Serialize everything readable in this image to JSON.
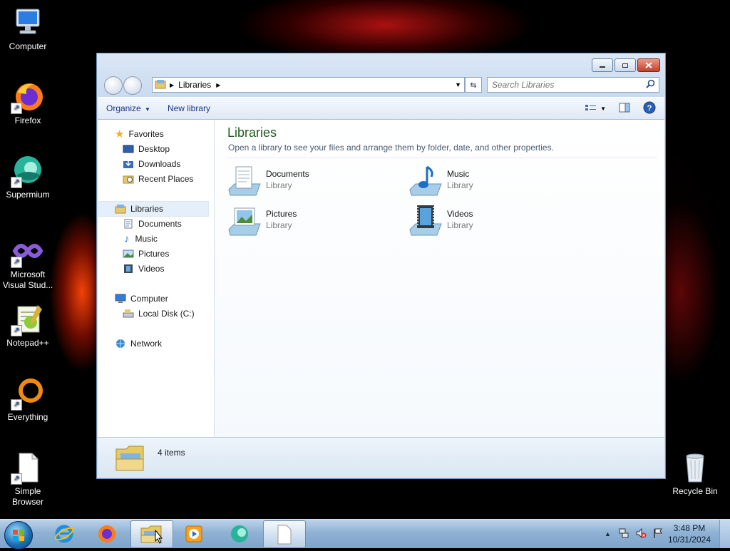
{
  "desktop": {
    "icons": [
      {
        "label": "Computer"
      },
      {
        "label": "Firefox"
      },
      {
        "label": "Supermium"
      },
      {
        "label": "Microsoft Visual Stud..."
      },
      {
        "label": "Notepad++"
      },
      {
        "label": "Everything"
      },
      {
        "label": "Simple Browser"
      },
      {
        "label": "Recycle Bin"
      }
    ]
  },
  "window": {
    "address_crumb": "Libraries",
    "search_placeholder": "Search Libraries",
    "toolbar": {
      "organize": "Organize",
      "new_library": "New library"
    },
    "nav": {
      "favorites": "Favorites",
      "desktop": "Desktop",
      "downloads": "Downloads",
      "recent_places": "Recent Places",
      "libraries": "Libraries",
      "documents": "Documents",
      "music": "Music",
      "pictures": "Pictures",
      "videos": "Videos",
      "computer": "Computer",
      "local_disk": "Local Disk (C:)",
      "network": "Network"
    },
    "main": {
      "title": "Libraries",
      "subtitle": "Open a library to see your files and arrange them by folder, date, and other properties.",
      "items": [
        {
          "name": "Documents",
          "type": "Library"
        },
        {
          "name": "Music",
          "type": "Library"
        },
        {
          "name": "Pictures",
          "type": "Library"
        },
        {
          "name": "Videos",
          "type": "Library"
        }
      ]
    },
    "details": {
      "count": "4 items"
    }
  },
  "taskbar": {
    "time": "3:48 PM",
    "date": "10/31/2024"
  },
  "colors": {
    "title_green": "#1e5d1e",
    "link_blue": "#1e3287",
    "close_red": "#c4402a"
  }
}
